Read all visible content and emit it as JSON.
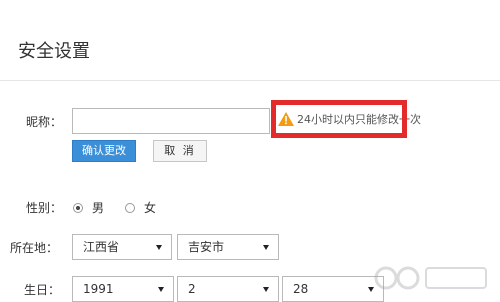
{
  "page": {
    "title": "安全设置"
  },
  "nickname": {
    "label": "昵称：",
    "value": "",
    "confirm_label": "确认更改",
    "cancel_label": "取 消",
    "hint": "24小时以内只能修改一次",
    "warning_icon": "warning-triangle",
    "warning_color": "#f39c12",
    "highlight_color": "#e32b2b"
  },
  "gender": {
    "label": "性别：",
    "options": [
      {
        "label": "男",
        "checked": true
      },
      {
        "label": "女",
        "checked": false
      }
    ]
  },
  "location": {
    "label": "所在地：",
    "province": "江西省",
    "city": "吉安市"
  },
  "birthday": {
    "label": "生日：",
    "year": "1991",
    "month": "2",
    "day": "28"
  },
  "colors": {
    "primary_button": "#3a8fd8",
    "border": "#b9b9b9"
  }
}
